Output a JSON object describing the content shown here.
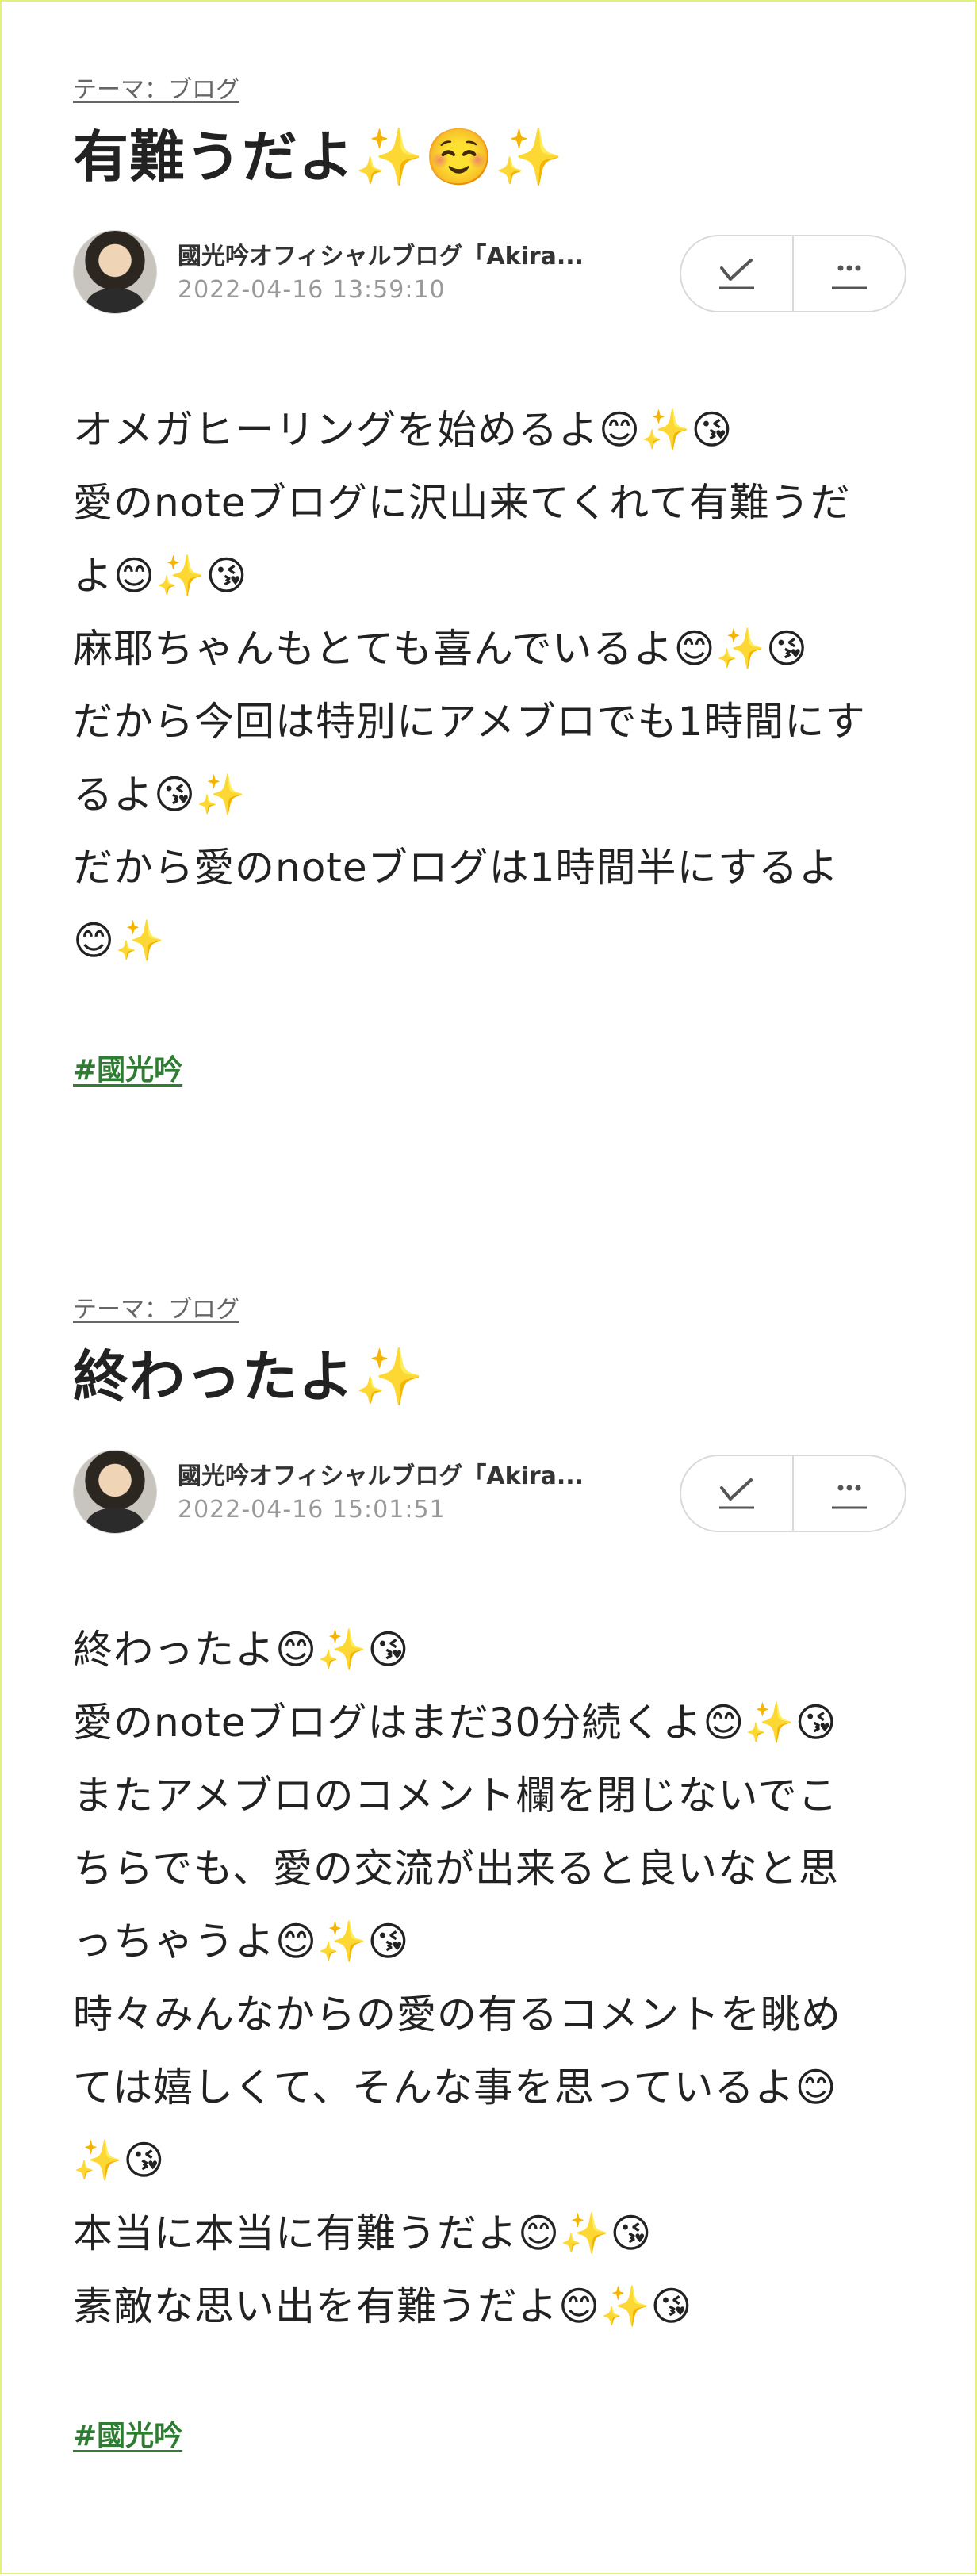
{
  "posts": [
    {
      "theme": "テーマ：ブログ",
      "title": "有難うだよ✨☺️✨",
      "author": "國光吟オフィシャルブログ「Akira...",
      "date": "2022-04-16 13:59:10",
      "body_lines": [
        "オメガヒーリングを始めるよ😊✨😘",
        "愛のnoteブログに沢山来てくれて有難うだ",
        "よ😊✨😘",
        "麻耶ちゃんもとても喜んでいるよ😊✨😘",
        "だから今回は特別にアメブロでも1時間にす",
        "るよ😘✨",
        "だから愛のnoteブログは1時間半にするよ",
        "😊✨"
      ],
      "hashtag": "#國光吟"
    },
    {
      "theme": "テーマ：ブログ",
      "title": "終わったよ✨",
      "author": "國光吟オフィシャルブログ「Akira...",
      "date": "2022-04-16 15:01:51",
      "body_lines": [
        "終わったよ😊✨😘",
        "愛のnoteブログはまだ30分続くよ😊✨😘",
        "またアメブロのコメント欄を閉じないでこ",
        "ちらでも、愛の交流が出来ると良いなと思",
        "っちゃうよ😊✨😘",
        "時々みんなからの愛の有るコメントを眺め",
        "ては嬉しくて、そんな事を思っているよ😊",
        "✨😘",
        "本当に本当に有難うだよ😊✨😘",
        "素敵な思い出を有難うだよ😊✨😘"
      ],
      "hashtag": "#國光吟"
    }
  ],
  "icons": {
    "avatar": "author-photo",
    "check": "check-icon",
    "more": "more-icon"
  },
  "colors": {
    "hashtag": "#2e7d32",
    "date": "#999999",
    "button_border": "#d9d9d9",
    "outer_border": "#e6f17a"
  }
}
